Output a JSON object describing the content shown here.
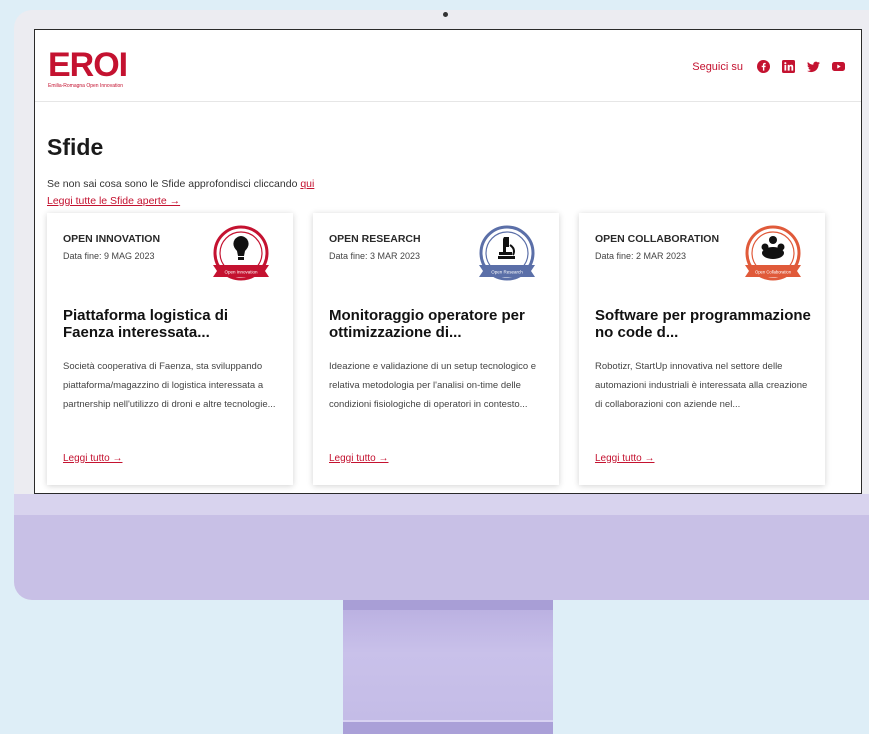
{
  "header": {
    "logo": "EROI",
    "logo_sub": "Emilia-Romagna Open Innovation",
    "follow_label": "Seguici su",
    "social": [
      "facebook-icon",
      "linkedin-icon",
      "twitter-icon",
      "youtube-icon"
    ]
  },
  "page": {
    "title": "Sfide",
    "intro": "Se non sai cosa sono le Sfide approfondisci cliccando ",
    "intro_link": "qui",
    "all_link": "Leggi tutte le Sfide aperte →"
  },
  "cards": [
    {
      "category": "OPEN INNOVATION",
      "date": "Data fine: 9 MAG 2023",
      "badge_label": "Open Innovation",
      "badge_color": "#c41230",
      "title": "Piattaforma logistica di Faenza interessata...",
      "description": "Società cooperativa di Faenza, sta sviluppando piattaforma/magazzino di logistica interessata a partnership nell'utilizzo di droni e altre tecnologie...",
      "link": "Leggi tutto →"
    },
    {
      "category": "OPEN RESEARCH",
      "date": "Data fine: 3 MAR 2023",
      "badge_label": "Open Research",
      "badge_color": "#5b6fa8",
      "title": "Monitoraggio operatore per ottimizzazione di...",
      "description": "Ideazione e validazione di un setup tecnologico e relativa metodologia per l'analisi on-time delle condizioni fisiologiche di operatori in contesto...",
      "link": "Leggi tutto →"
    },
    {
      "category": "OPEN COLLABORATION",
      "date": "Data fine: 2 MAR 2023",
      "badge_label": "Open Collaboration",
      "badge_color": "#e05a3a",
      "title": "Software per programmazione no code d...",
      "description": "Robotizr, StartUp innovativa nel settore delle automazioni industriali è interessata alla creazione di collaborazioni con aziende nel...",
      "link": "Leggi tutto →"
    }
  ],
  "colors": {
    "brand": "#c41230",
    "chin": "#c8c0e6",
    "background": "#deeef7"
  }
}
